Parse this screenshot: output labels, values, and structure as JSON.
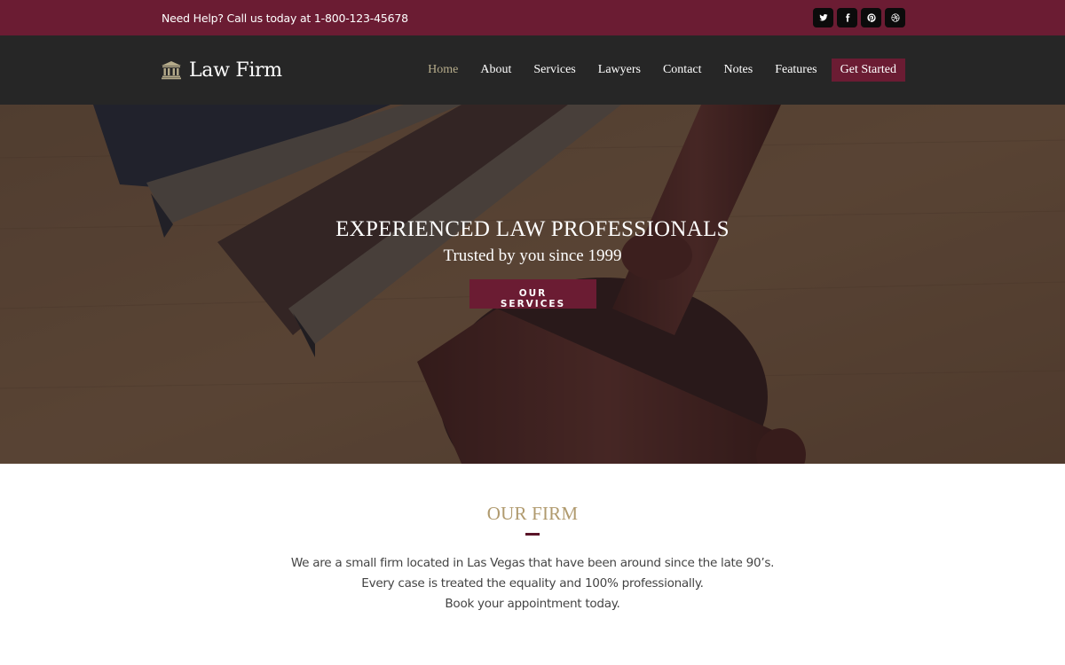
{
  "topbar": {
    "help_text": "Need Help? Call us today at 1-800-123-45678",
    "social": [
      {
        "icon": "twitter-icon",
        "label": "Twitter"
      },
      {
        "icon": "facebook-icon",
        "label": "Facebook"
      },
      {
        "icon": "pinterest-icon",
        "label": "Pinterest"
      },
      {
        "icon": "dribbble-icon",
        "label": "Dribbble"
      }
    ]
  },
  "header": {
    "logo_icon": "courthouse-icon",
    "logo_text": "Law Firm",
    "nav": [
      {
        "label": "Home",
        "active": true
      },
      {
        "label": "About"
      },
      {
        "label": "Services"
      },
      {
        "label": "Lawyers"
      },
      {
        "label": "Contact"
      },
      {
        "label": "Notes"
      },
      {
        "label": "Features"
      }
    ],
    "cta_label": "Get Started"
  },
  "hero": {
    "title": "EXPERIENCED LAW PROFESSIONALS",
    "subtitle": "Trusted by you since 1999",
    "button_label": "OUR SERVICES"
  },
  "firm": {
    "heading": "OUR FIRM",
    "lines": [
      "We are a small firm located in Las Vegas that have been around since the late 90’s.",
      "Every case is treated the equality and 100% professionally.",
      "Book your appointment today."
    ]
  },
  "colors": {
    "brand_maroon": "#6b1c33",
    "header_dark": "#262626",
    "gold_accent": "#b09a6e",
    "nav_active": "#b5ab8a",
    "body_text": "#444444"
  }
}
